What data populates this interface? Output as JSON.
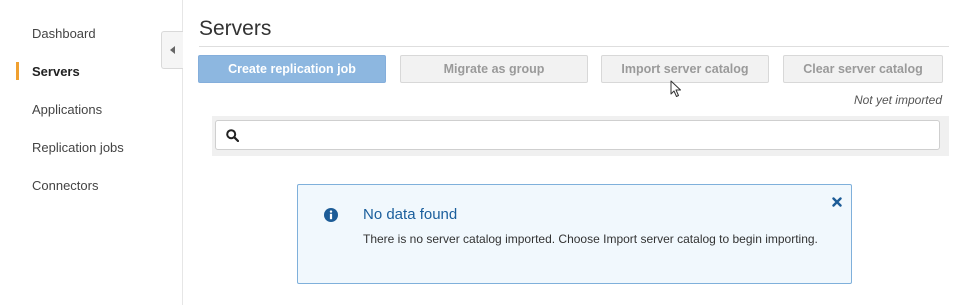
{
  "sidebar": {
    "items": [
      {
        "label": "Dashboard",
        "active": false
      },
      {
        "label": "Servers",
        "active": true
      },
      {
        "label": "Applications",
        "active": false
      },
      {
        "label": "Replication jobs",
        "active": false
      },
      {
        "label": "Connectors",
        "active": false
      }
    ],
    "collapse_icon": "chevron-left-icon"
  },
  "main": {
    "title": "Servers",
    "toolbar": {
      "create_replication_job": "Create replication job",
      "migrate_as_group": "Migrate as group",
      "import_server_catalog": "Import server catalog",
      "clear_server_catalog": "Clear server catalog"
    },
    "catalog_status": "Not yet imported",
    "search": {
      "value": "",
      "placeholder": "",
      "icon": "search-icon"
    },
    "alert": {
      "icon": "info-icon",
      "title": "No data found",
      "message": "There is no server catalog imported. Choose Import server catalog to begin importing.",
      "close_icon": "close-icon"
    }
  },
  "colors": {
    "primary_button": "#8db7e0",
    "active_indicator": "#f0a030",
    "alert_border": "#7fb0db",
    "alert_background": "#f1f8fd",
    "alert_title": "#1a5e9c"
  }
}
